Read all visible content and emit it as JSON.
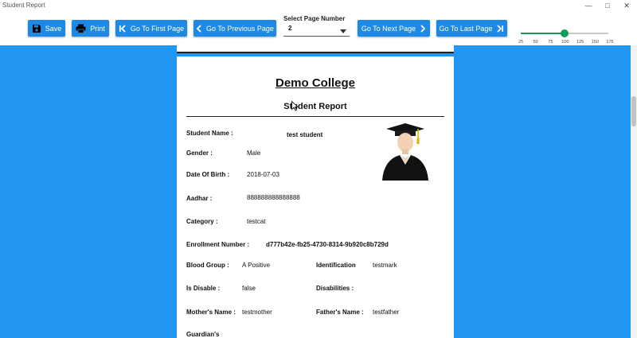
{
  "window": {
    "title": "Student Report"
  },
  "toolbar": {
    "save": "Save",
    "print": "Print",
    "first": "Go To First Page",
    "previous": "Go To Previous Page",
    "select_label": "Select Page Number",
    "select_value": "2",
    "next": "Go To Next Page",
    "last": "Go To Last Page"
  },
  "zoom": {
    "value": 100,
    "ticks": [
      "25",
      "50",
      "75",
      "100",
      "125",
      "150",
      "175"
    ]
  },
  "report": {
    "college": "Demo College",
    "title": "Student Report",
    "student_name_label": "Student Name :",
    "student_name": "test student",
    "gender_label": "Gender :",
    "gender": "Male",
    "dob_label": "Date Of Birth :",
    "dob": "2018-07-03",
    "aadhar_label": "Aadhar :",
    "aadhar": "888888888888888",
    "category_label": "Category :",
    "category": "testcat",
    "enrollment_label": "Enrollment Number :",
    "enrollment": "d777b42e-fb25-4730-8314-9b920c8b729d",
    "blood_group_label": "Blood Group :",
    "blood_group": "A Positive",
    "identification_label": "Identification",
    "identification": "testmark",
    "is_disable_label": "Is Disable :",
    "is_disable": "false",
    "disabilities_label": "Disabilities :",
    "mother_label": "Mother's Name :",
    "mother": "testmother",
    "father_label": "Father's Name :",
    "father": "testfather",
    "guardian_label": "Guardian's"
  },
  "icons": {
    "save": "save-icon",
    "print": "printer-icon",
    "first": "first-page-icon",
    "previous": "chevron-left-icon",
    "next": "chevron-right-icon",
    "last": "last-page-icon",
    "avatar": "graduate-avatar-icon"
  },
  "colors": {
    "button": "#1e88e5",
    "viewer_bg": "#2196f3",
    "slider": "#0f9d58"
  }
}
